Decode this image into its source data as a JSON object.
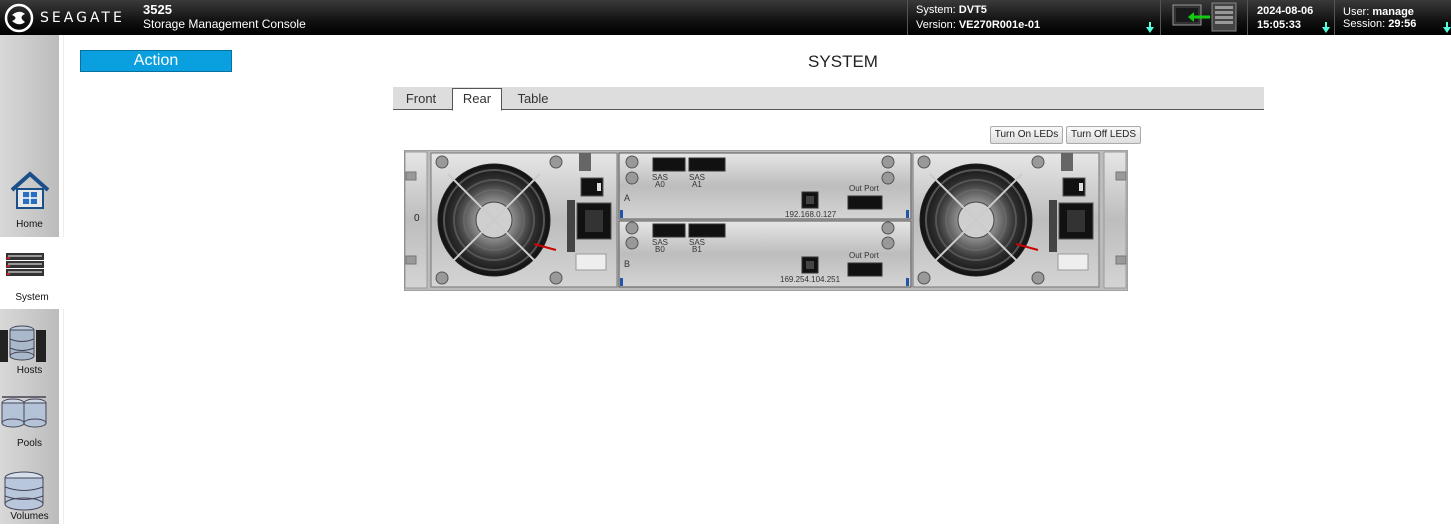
{
  "header": {
    "brand": "SEAGATE",
    "model": "3525",
    "subtitle": "Storage Management Console",
    "system_label": "System:",
    "system_value": "DVT5",
    "version_label": "Version:",
    "version_value": "VE270R001e-01",
    "date": "2024-08-06",
    "time": "15:05:33",
    "user_label": "User:",
    "user_value": "manage",
    "session_label": "Session:",
    "session_value": "29:56"
  },
  "sidebar": {
    "items": [
      {
        "label": "Home",
        "icon": "home-icon"
      },
      {
        "label": "System",
        "icon": "system-icon"
      },
      {
        "label": "Hosts",
        "icon": "hosts-icon"
      },
      {
        "label": "Pools",
        "icon": "pools-icon"
      },
      {
        "label": "Volumes",
        "icon": "volumes-icon"
      }
    ],
    "active": "System"
  },
  "action_label": "Action",
  "page_title": "SYSTEM",
  "tabs": [
    {
      "label": "Front"
    },
    {
      "label": "Rear"
    },
    {
      "label": "Table"
    }
  ],
  "active_tab": "Rear",
  "led_buttons": {
    "on": "Turn On LEDs",
    "off": "Turn Off LEDS"
  },
  "enclosure": {
    "id": "0",
    "controllers": [
      {
        "letter": "A",
        "port0": "SAS\nA0",
        "port0_a": "SAS",
        "port0_b": "A0",
        "port1_a": "SAS",
        "port1_b": "A1",
        "ip": "192.168.0.127",
        "out_port": "Out Port"
      },
      {
        "letter": "B",
        "port0_a": "SAS",
        "port0_b": "B0",
        "port1_a": "SAS",
        "port1_b": "B1",
        "ip": "169.254.104.251",
        "out_port": "Out Port"
      }
    ]
  }
}
